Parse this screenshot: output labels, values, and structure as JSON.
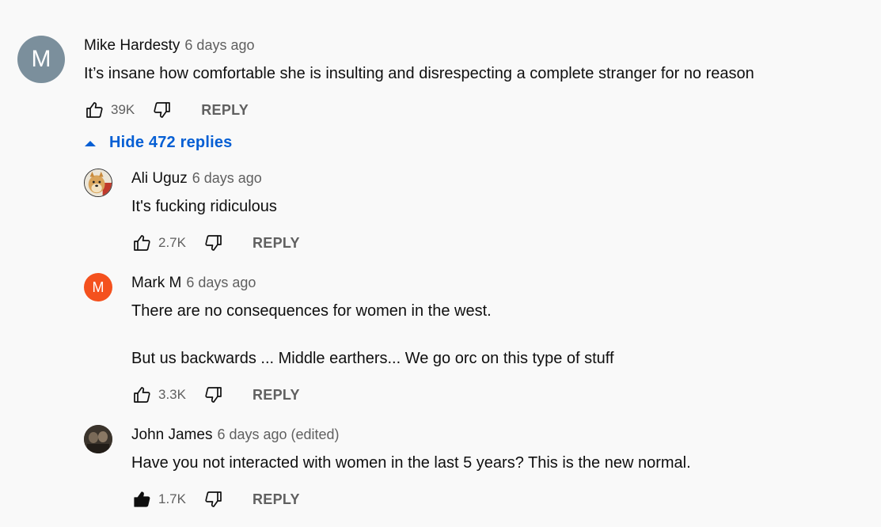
{
  "colors": {
    "background": "#f9f9f9",
    "link_blue": "#065fd4",
    "muted": "#606060",
    "avatar_mike": "#7b8f9c",
    "avatar_mark": "#f4511e"
  },
  "top_comment": {
    "avatar_letter": "M",
    "author": "Mike Hardesty",
    "time": "6 days ago",
    "text": "It’s insane how comfortable she is insulting and disrespecting a complete stranger for no reason",
    "likes": "39K",
    "reply_label": "REPLY",
    "toggle_label": "Hide 472 replies",
    "toggle_icon": "triangle-up-icon"
  },
  "replies": [
    {
      "author": "Ali Uguz",
      "time": "6 days ago",
      "text": "It's fucking ridiculous",
      "likes": "2.7K",
      "reply_label": "REPLY",
      "avatar_icon": "doge-avatar"
    },
    {
      "author": "Mark M",
      "avatar_letter": "M",
      "time": "6 days ago",
      "text_line1": "There are no consequences for women in the west.",
      "text_line2": "But us backwards ... Middle earthers... We go orc on this type of stuff",
      "likes": "3.3K",
      "reply_label": "REPLY"
    },
    {
      "author": "John James",
      "time": "6 days ago (edited)",
      "text": "Have you not interacted with women in the last 5 years? This is the new normal.",
      "likes": "1.7K",
      "reply_label": "REPLY",
      "liked": true,
      "avatar_icon": "photo-avatar"
    }
  ]
}
